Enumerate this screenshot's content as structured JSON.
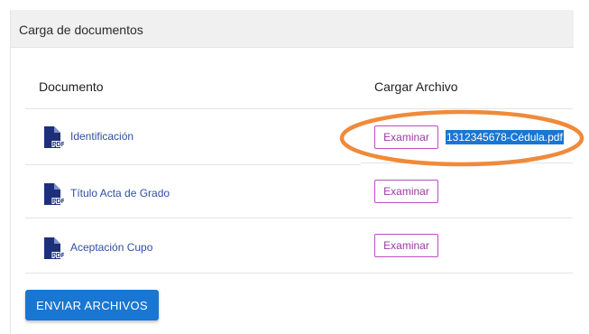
{
  "panel": {
    "title": "Carga de documentos"
  },
  "table": {
    "headers": {
      "document": "Documento",
      "upload": "Cargar Archivo"
    },
    "rows": [
      {
        "label": "Identificación",
        "button": "Examinar",
        "file": "1312345678-Cédula.pdf",
        "icon": "pdf-file-icon"
      },
      {
        "label": "Título Acta de Grado",
        "button": "Examinar",
        "file": "",
        "icon": "pdf-file-icon"
      },
      {
        "label": "Aceptación Cupo",
        "button": "Examinar",
        "file": "",
        "icon": "pdf-file-icon"
      }
    ]
  },
  "submit": {
    "label": "ENVIAR ARCHIVOS"
  },
  "colors": {
    "primary": "#1976d2",
    "browse_border": "#b94fc0",
    "doc_link": "#2f4fa3",
    "annotation": "#f08a3a",
    "pdf_icon": "#1d2f7a"
  }
}
